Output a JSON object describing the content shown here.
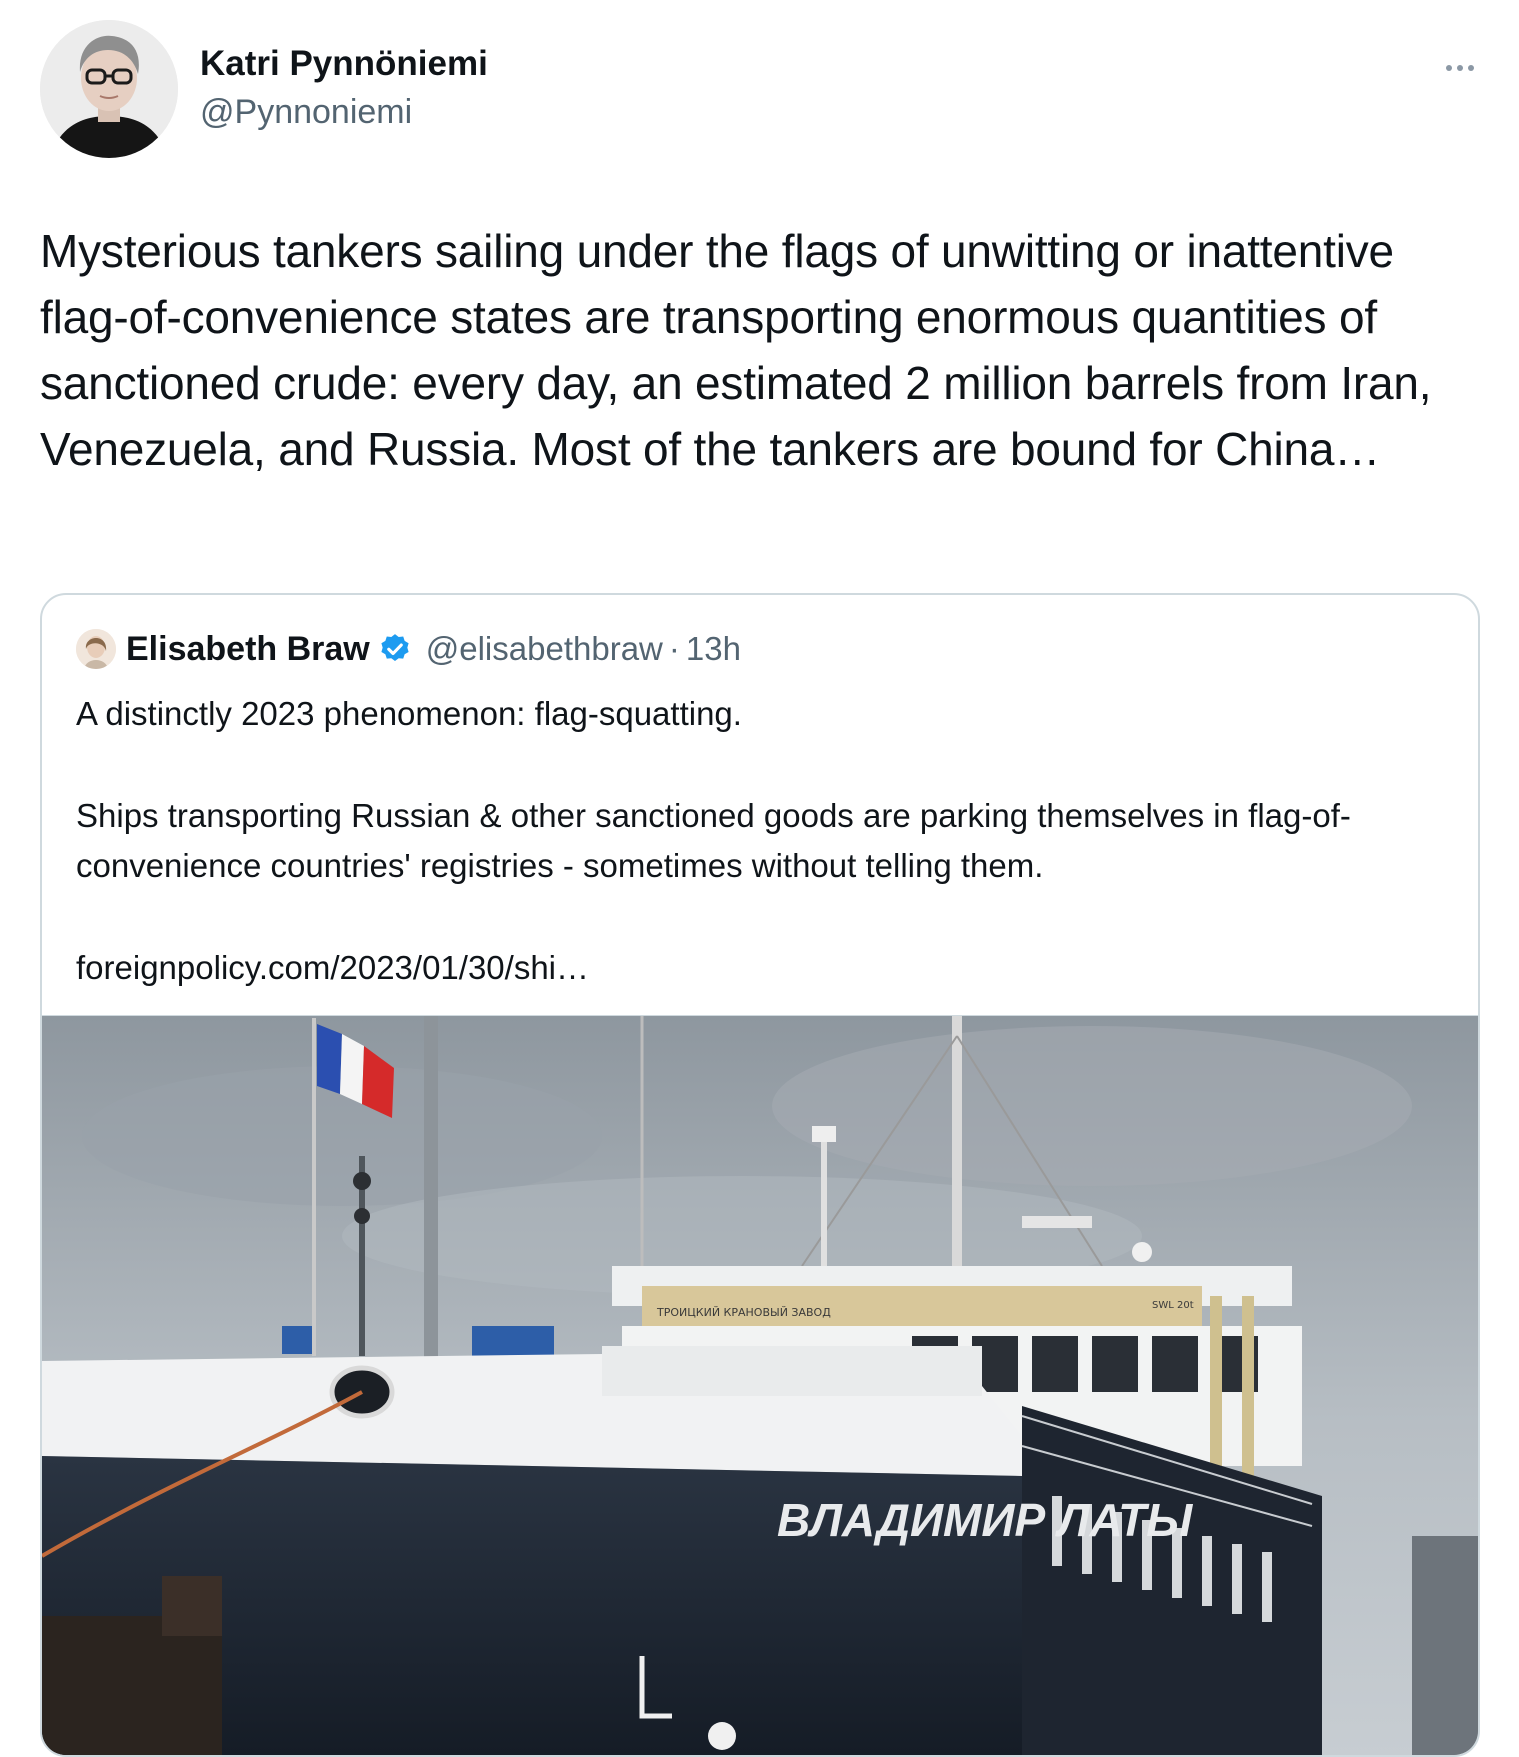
{
  "author": {
    "name": "Katri Pynnöniemi",
    "handle": "@Pynnoniemi"
  },
  "tweet": {
    "text": "Mysterious tankers sailing under the flags of unwitting or inattentive flag-of-convenience states are transporting enormous quantities of sanctioned crude: every day, an estimated 2 million barrels from Iran, Venezuela, and Russia. Most of the tankers are bound for China…"
  },
  "more_icon": "more-horizontal-icon",
  "quoted": {
    "name": "Elisabeth Braw",
    "verified_icon": "verified-badge-icon",
    "handle": "@elisabethbraw",
    "separator": "·",
    "time": "13h",
    "line1": "A distinctly 2023 phenomenon: flag-squatting.",
    "line2": "Ships transporting Russian & other sanctioned goods are parking themselves in flag-of-convenience countries' registries - sometimes without telling them.",
    "link": "foreignpolicy.com/2023/01/30/shi…",
    "image": {
      "ship_name": "ВЛАДИМИР ЛАТЫ",
      "crane_label": "ТРОИЦКИЙ КРАНОВЫЙ ЗАВОД",
      "swl_label": "SWL 20t"
    }
  },
  "colors": {
    "text": "#0f1419",
    "secondary": "#536471",
    "border": "#cfd9de",
    "verified": "#1d9bf0"
  }
}
